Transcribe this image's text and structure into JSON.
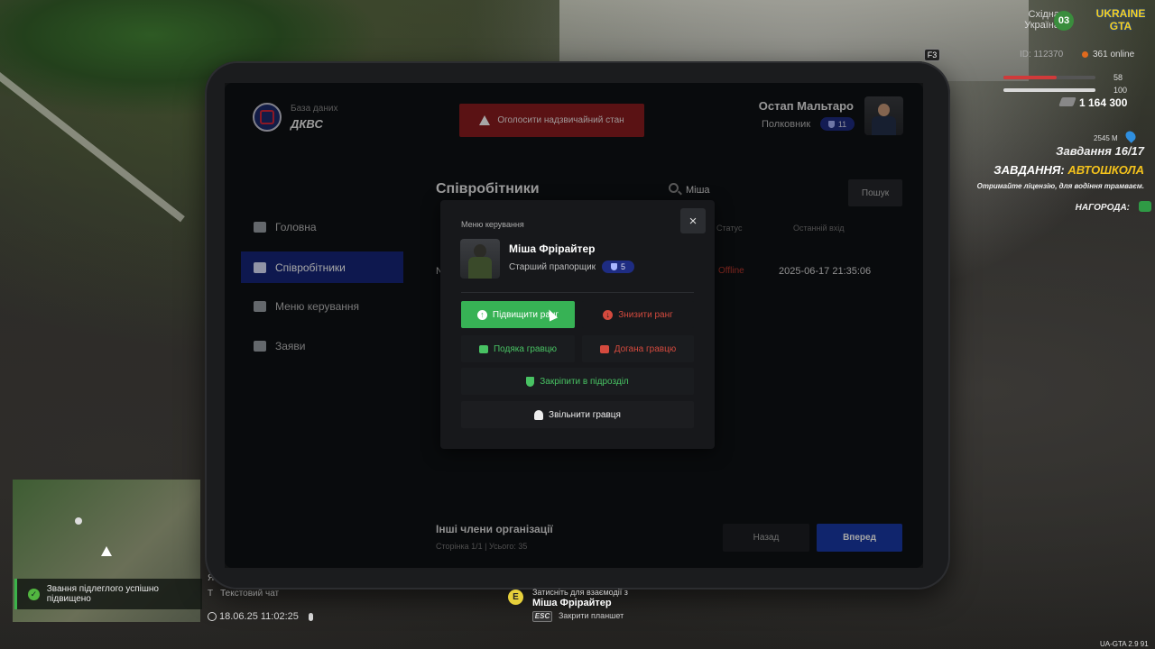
{
  "hud": {
    "region_line1": "Східна",
    "region_line2": "Україна",
    "zone_number": "03",
    "logo_line1": "UKRAINE",
    "logo_line2": "GTA",
    "f_key": "F3",
    "player_id": "ID: 112370",
    "online": "361 online",
    "health": 58,
    "armor": 100,
    "health_label": "58",
    "armor_label": "100",
    "money": "1 164 300",
    "distance": "2545 M",
    "task_progress": "Завдання 16/17",
    "task_prefix": "ЗАВДАННЯ: ",
    "task_name": "АВТОШКОЛА",
    "task_desc": "Отримайте ліцензію, для водіння трамваєм.",
    "reward_label": "НАГОРОДА:",
    "colors": {
      "health": "#d03a3a",
      "armor": "#d8d8d8",
      "accent": "#f5c31c"
    }
  },
  "notification": {
    "text": "Звання підлеглого успішно підвищено",
    "icon": "check-icon"
  },
  "chat": {
    "key_y": "Я",
    "key_t": "T",
    "label": "Текстовий чат",
    "datetime": "18.06.25 11:02:25"
  },
  "interaction": {
    "key": "E",
    "line1": "Затисніть для взаємодії з",
    "target": "Міша Фрірайтер",
    "esc_key": "ESC",
    "esc_label": "Закрити планшет"
  },
  "version": "UA-GTA 2.9   91",
  "tablet": {
    "brand_sub": "База даних",
    "brand_title": "ДКВС",
    "emergency_button": "Оголосити надзвичайний стан",
    "user": {
      "name": "Остап Мальтаро",
      "rank": "Полковник",
      "rank_level": "11"
    },
    "nav": [
      {
        "label": "Головна",
        "icon": "home-icon"
      },
      {
        "label": "Співробітники",
        "icon": "users-icon",
        "active": true
      },
      {
        "label": "Меню керування",
        "icon": "gear-icon"
      },
      {
        "label": "Заяви",
        "icon": "folder-icon"
      }
    ],
    "section_title": "Співробітники",
    "search": {
      "value": "Міша",
      "button": "Пошук"
    },
    "table": {
      "headers": [
        "Статус",
        "Останній вхід"
      ],
      "row": {
        "name_initial": "N",
        "status": "Offline",
        "last_login": "2025-06-17 21:35:06"
      }
    },
    "footer": {
      "title": "Інші члени організації",
      "subtitle": "Сторінка 1/1 | Усього: 35",
      "back": "Назад",
      "next": "Вперед"
    }
  },
  "modal": {
    "label": "Меню керування",
    "close": "×",
    "employee": {
      "name": "Міша Фрірайтер",
      "rank": "Старший прапорщик",
      "rank_level": "5"
    },
    "actions": {
      "promote": "Підвищити ранг",
      "demote": "Знизити ранг",
      "thanks": "Подяка гравцю",
      "rebuke": "Догана гравцю",
      "assign": "Закріпити в підрозділ",
      "fire": "Звільнити гравця"
    },
    "colors": {
      "positive": "#37b255",
      "negative": "#d44a3e"
    }
  }
}
